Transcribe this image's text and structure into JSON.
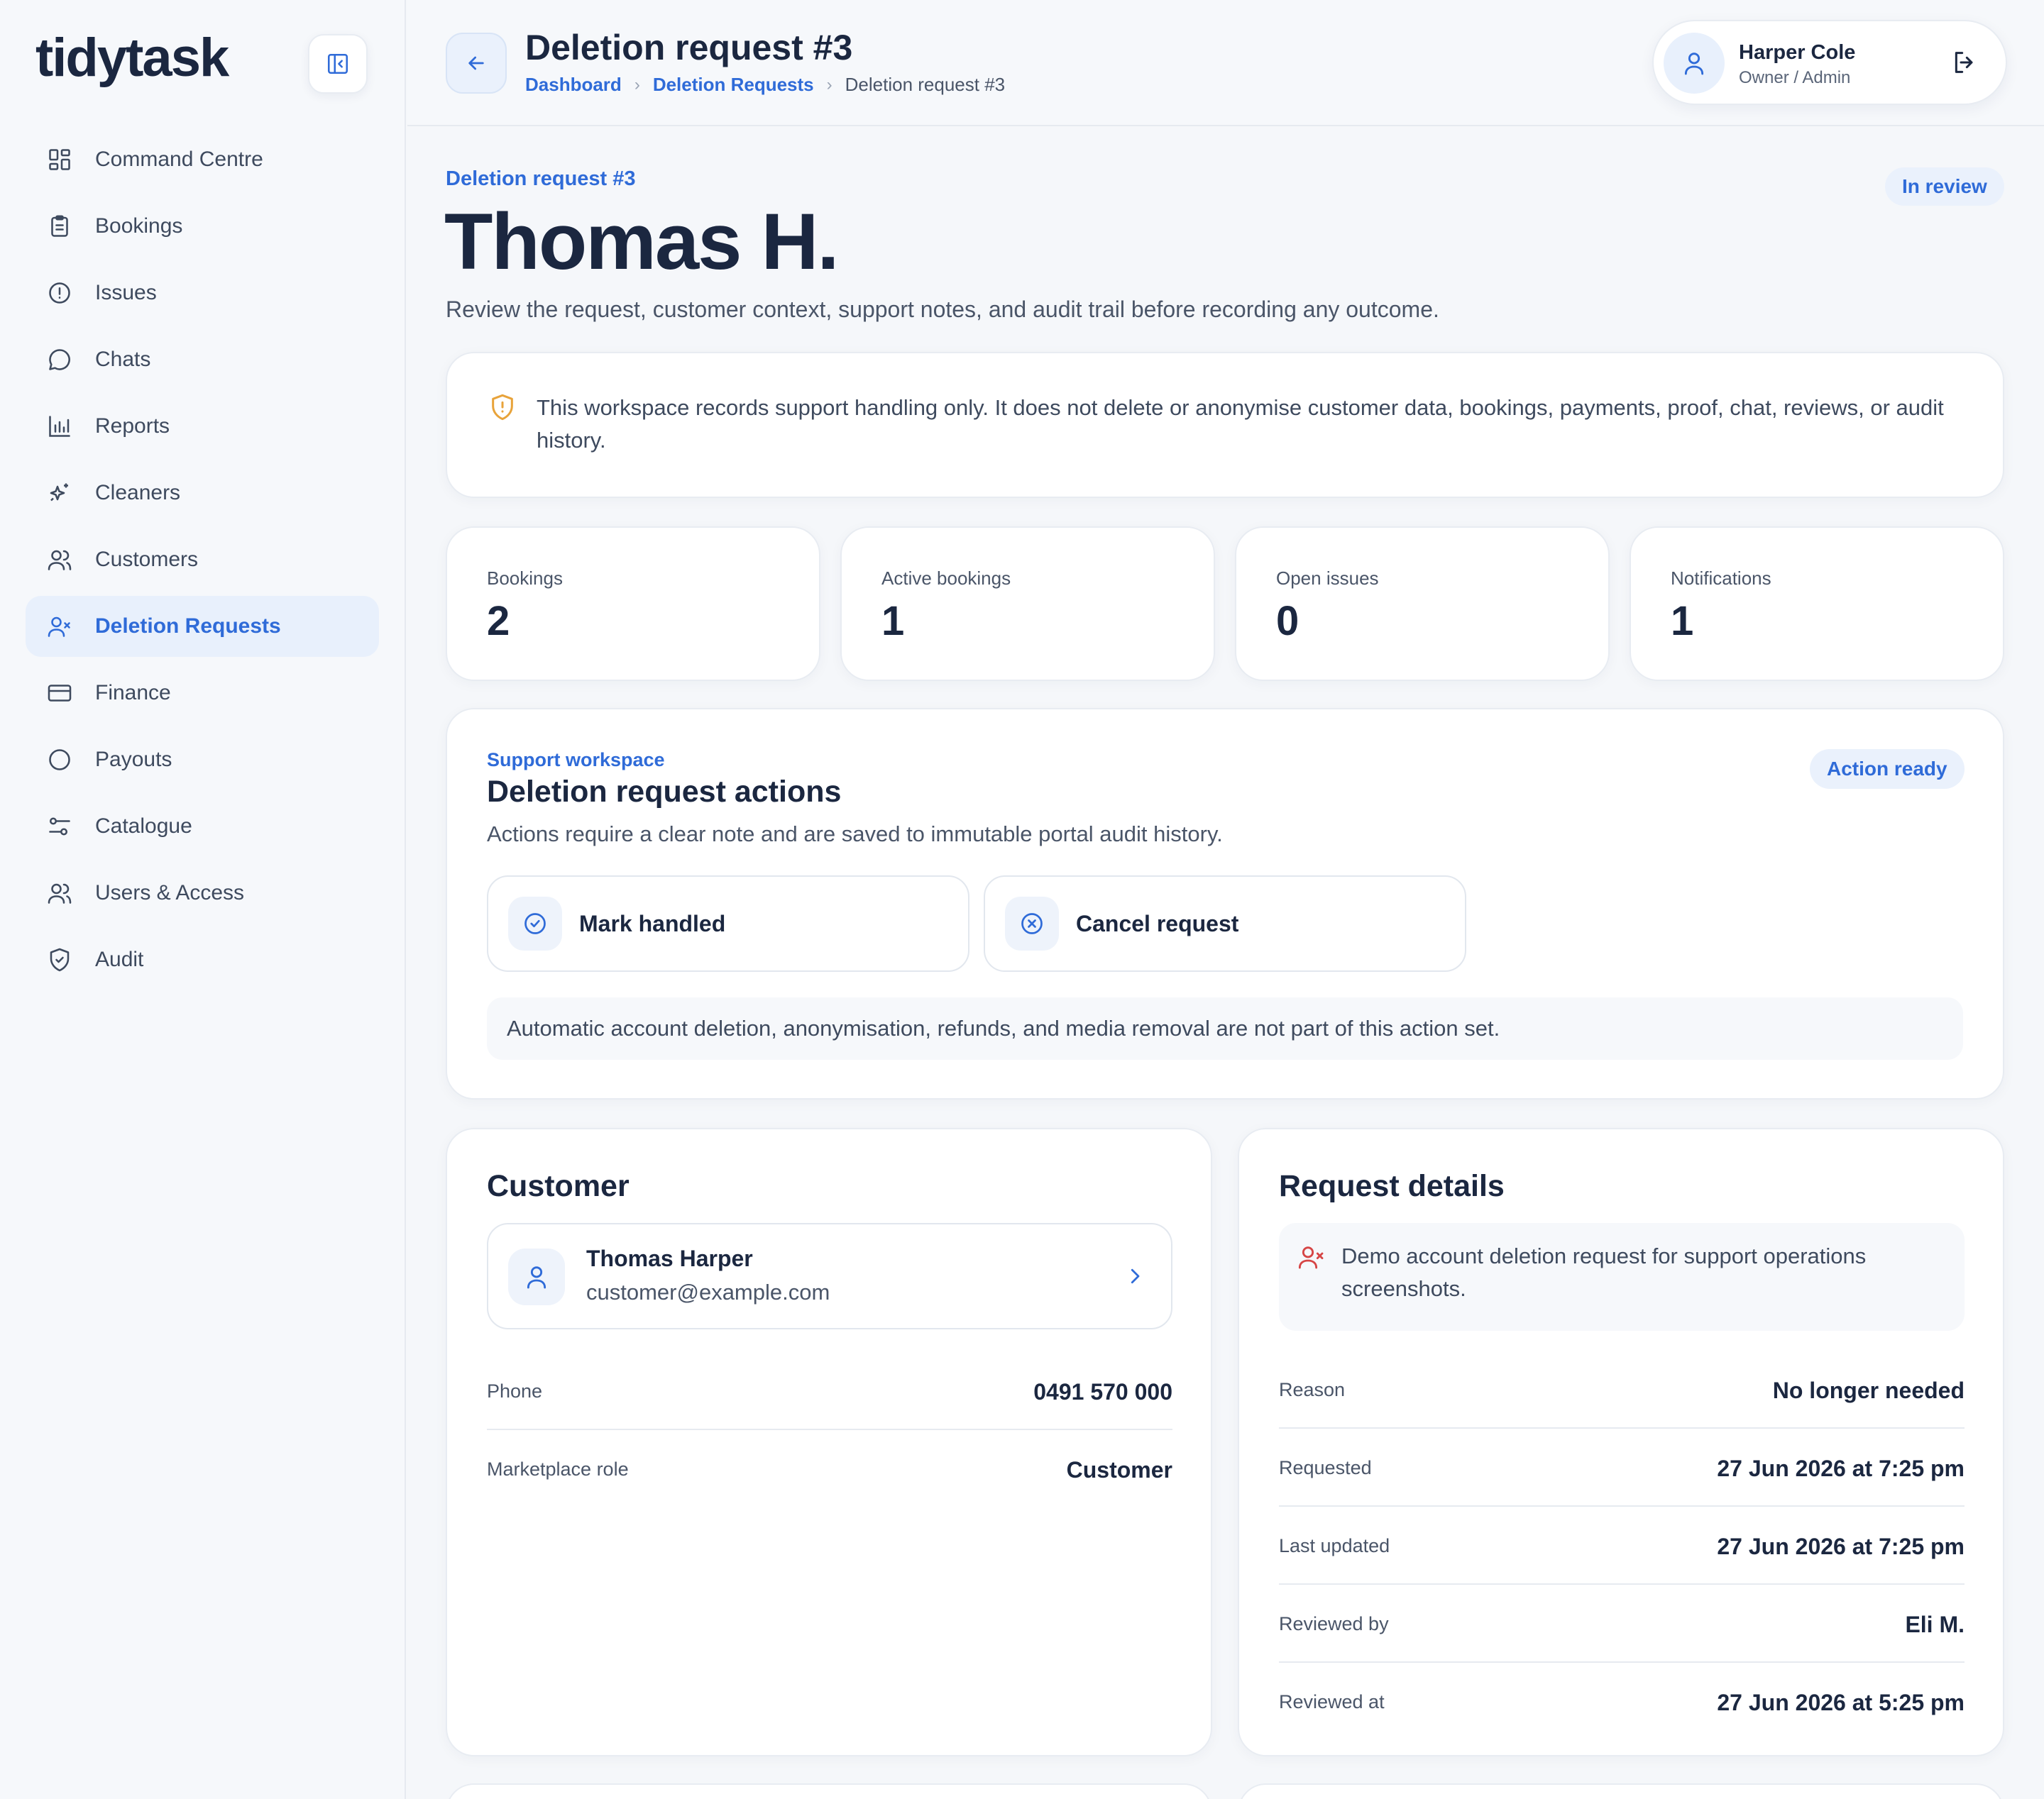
{
  "app": {
    "name": "tidytask"
  },
  "sidebar": {
    "items": [
      {
        "label": "Command Centre",
        "icon": "grid-icon",
        "active": false
      },
      {
        "label": "Bookings",
        "icon": "clipboard-icon",
        "active": false
      },
      {
        "label": "Issues",
        "icon": "alert-circle-icon",
        "active": false
      },
      {
        "label": "Chats",
        "icon": "chat-bubble-icon",
        "active": false
      },
      {
        "label": "Reports",
        "icon": "bar-chart-icon",
        "active": false
      },
      {
        "label": "Cleaners",
        "icon": "sparkle-icon",
        "active": false
      },
      {
        "label": "Customers",
        "icon": "users-icon",
        "active": false
      },
      {
        "label": "Deletion Requests",
        "icon": "user-x-icon",
        "active": true
      },
      {
        "label": "Finance",
        "icon": "credit-card-icon",
        "active": false
      },
      {
        "label": "Payouts",
        "icon": "circle-icon",
        "active": false
      },
      {
        "label": "Catalogue",
        "icon": "sliders-icon",
        "active": false
      },
      {
        "label": "Users & Access",
        "icon": "users-icon",
        "active": false
      },
      {
        "label": "Audit",
        "icon": "shield-check-icon",
        "active": false
      }
    ]
  },
  "header": {
    "title": "Deletion request #3",
    "breadcrumb": [
      "Dashboard",
      "Deletion Requests",
      "Deletion request #3"
    ],
    "user": {
      "name": "Harper Cole",
      "role": "Owner / Admin"
    }
  },
  "hero": {
    "eyebrow": "Deletion request #3",
    "name": "Thomas H.",
    "subtitle": "Review the request, customer context, support notes, and audit trail before recording any outcome.",
    "status": "In review"
  },
  "notice": {
    "text": "This workspace records support handling only. It does not delete or anonymise customer data, bookings, payments, proof, chat, reviews, or audit history."
  },
  "stats": [
    {
      "label": "Bookings",
      "value": "2"
    },
    {
      "label": "Active bookings",
      "value": "1"
    },
    {
      "label": "Open issues",
      "value": "0"
    },
    {
      "label": "Notifications",
      "value": "1"
    }
  ],
  "actions": {
    "eyebrow": "Support workspace",
    "title": "Deletion request actions",
    "subtitle": "Actions require a clear note and are saved to immutable portal audit history.",
    "status": "Action ready",
    "buttons": [
      "Mark handled",
      "Cancel request"
    ],
    "footnote": "Automatic account deletion, anonymisation, refunds, and media removal are not part of this action set."
  },
  "customer": {
    "title": "Customer",
    "name": "Thomas Harper",
    "email": "customer@example.com",
    "fields": [
      {
        "label": "Phone",
        "value": "0491 570 000"
      },
      {
        "label": "Marketplace role",
        "value": "Customer"
      }
    ]
  },
  "request": {
    "title": "Request details",
    "note": "Demo account deletion request for support operations screenshots.",
    "fields": [
      {
        "label": "Reason",
        "value": "No longer needed"
      },
      {
        "label": "Requested",
        "value": "27 Jun 2026 at 7:25 pm"
      },
      {
        "label": "Last updated",
        "value": "27 Jun 2026 at 7:25 pm"
      },
      {
        "label": "Reviewed by",
        "value": "Eli M."
      },
      {
        "label": "Reviewed at",
        "value": "27 Jun 2026 at 5:25 pm"
      }
    ]
  },
  "colors": {
    "accent": "#2f6bd8",
    "text": "#1b2740",
    "warning": "#e8a33a",
    "danger": "#d64545"
  }
}
